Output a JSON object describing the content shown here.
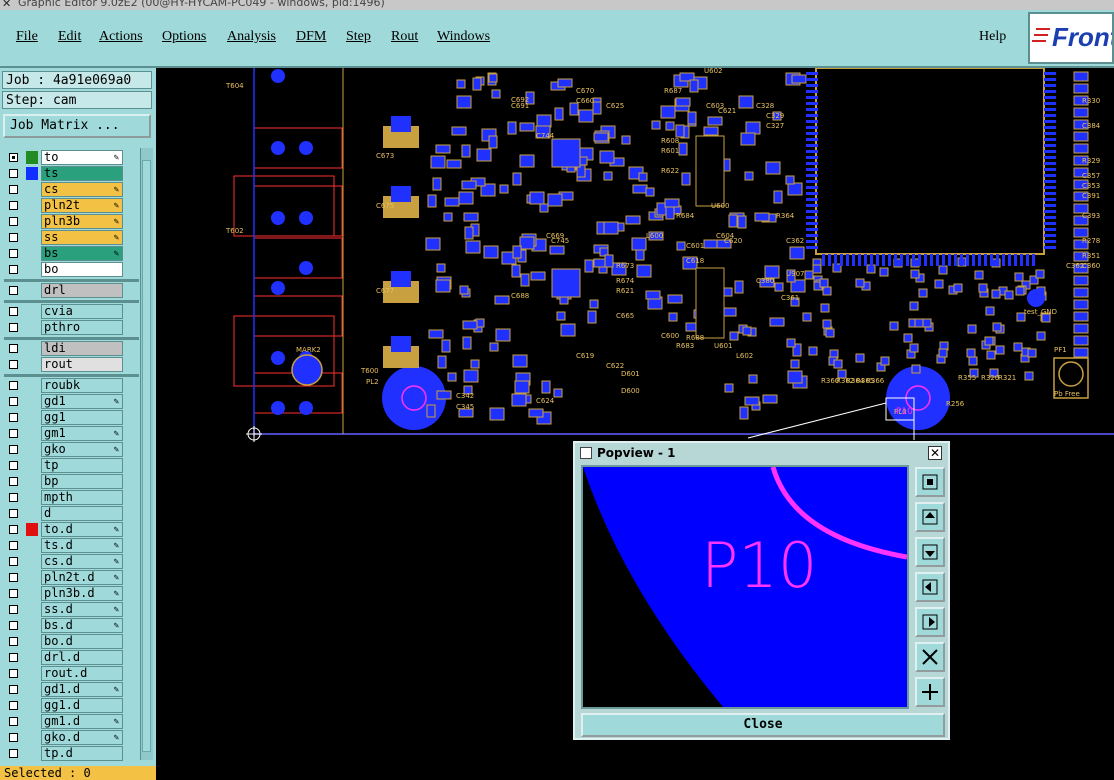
{
  "window": {
    "title": "Graphic Editor 9.0zE2 (00@HY-HYCAM-PC049 - windows, pid:1496)"
  },
  "menu": {
    "items": [
      "File",
      "Edit",
      "Actions",
      "Options",
      "Analysis",
      "DFM",
      "Step",
      "Rout",
      "Windows"
    ],
    "help": "Help",
    "logo": "Frontline"
  },
  "panel": {
    "job": "Job : 4a91e069a0",
    "step": "Step: cam",
    "job_matrix": "Job Matrix ...",
    "selected": "Selected : 0"
  },
  "layers": [
    {
      "name": "to",
      "color": "#ffffff",
      "swatch": "#228b22",
      "active": true,
      "edit": true
    },
    {
      "name": "ts",
      "color": "#2aa07c",
      "swatch": "#1030ff",
      "edit": false
    },
    {
      "name": "cs",
      "color": "#f3c244",
      "edit": true
    },
    {
      "name": "pln2t",
      "color": "#f3c244",
      "edit": true
    },
    {
      "name": "pln3b",
      "color": "#f3c244",
      "edit": true
    },
    {
      "name": "ss",
      "color": "#f3c244",
      "edit": true
    },
    {
      "name": "bs",
      "color": "#2aa07c",
      "edit": true
    },
    {
      "name": "bo",
      "color": "#ffffff",
      "edit": false
    },
    {
      "name": "drl",
      "color": "#c0c0c0",
      "edit": false,
      "gap": true
    },
    {
      "name": "cvia",
      "color": "#9fd9d9",
      "edit": false,
      "gap": true
    },
    {
      "name": "pthro",
      "color": "#9fd9d9",
      "edit": false
    },
    {
      "name": "ldi",
      "color": "#c0c0c0",
      "edit": false,
      "gap": true
    },
    {
      "name": "rout",
      "color": "#e0e0e0",
      "edit": false
    },
    {
      "name": "roubk",
      "color": "#9fd9d9",
      "edit": false,
      "gap": true
    },
    {
      "name": "gd1",
      "color": "#9fd9d9",
      "edit": true
    },
    {
      "name": "gg1",
      "color": "#9fd9d9",
      "edit": false
    },
    {
      "name": "gm1",
      "color": "#9fd9d9",
      "edit": true
    },
    {
      "name": "gko",
      "color": "#9fd9d9",
      "edit": true
    },
    {
      "name": "tp",
      "color": "#9fd9d9",
      "edit": false
    },
    {
      "name": "bp",
      "color": "#9fd9d9",
      "edit": false
    },
    {
      "name": "mpth",
      "color": "#9fd9d9",
      "edit": false
    },
    {
      "name": "d",
      "color": "#9fd9d9",
      "edit": false
    },
    {
      "name": "to.d",
      "color": "#9fd9d9",
      "swatch": "#e01010",
      "edit": true
    },
    {
      "name": "ts.d",
      "color": "#9fd9d9",
      "edit": true
    },
    {
      "name": "cs.d",
      "color": "#9fd9d9",
      "edit": true
    },
    {
      "name": "pln2t.d",
      "color": "#9fd9d9",
      "edit": true
    },
    {
      "name": "pln3b.d",
      "color": "#9fd9d9",
      "edit": true
    },
    {
      "name": "ss.d",
      "color": "#9fd9d9",
      "edit": true
    },
    {
      "name": "bs.d",
      "color": "#9fd9d9",
      "edit": true
    },
    {
      "name": "bo.d",
      "color": "#9fd9d9",
      "edit": false
    },
    {
      "name": "drl.d",
      "color": "#9fd9d9",
      "edit": false
    },
    {
      "name": "rout.d",
      "color": "#9fd9d9",
      "edit": false
    },
    {
      "name": "gd1.d",
      "color": "#9fd9d9",
      "edit": true
    },
    {
      "name": "gg1.d",
      "color": "#9fd9d9",
      "edit": false
    },
    {
      "name": "gm1.d",
      "color": "#9fd9d9",
      "edit": true
    },
    {
      "name": "gko.d",
      "color": "#9fd9d9",
      "edit": true
    },
    {
      "name": "tp.d",
      "color": "#9fd9d9",
      "edit": false
    }
  ],
  "canvas": {
    "labels": [
      "T604",
      "T602",
      "T600",
      "PL2",
      "PL0",
      "MARK2",
      "C345",
      "C342",
      "D600",
      "D601",
      "C624",
      "C619",
      "U600",
      "C745",
      "C669",
      "C688",
      "C691",
      "C692",
      "U601",
      "C601",
      "C604",
      "C620",
      "C618",
      "R687",
      "U602",
      "L600",
      "C603",
      "C621",
      "C361",
      "U907",
      "R364",
      "C362",
      "C384",
      "C353",
      "R330",
      "R329",
      "C391",
      "C393",
      "C357",
      "R278",
      "R351",
      "C360",
      "C362",
      "test_GND",
      "PF1",
      "Pb Free",
      "R360",
      "R362",
      "R364",
      "R365",
      "R366",
      "R256",
      "R355",
      "R320",
      "R321",
      "C625",
      "C622",
      "C677",
      "C675",
      "C673",
      "C665",
      "C670",
      "C660",
      "C744",
      "R673",
      "R674",
      "R621",
      "R622",
      "R608",
      "R601",
      "R684",
      "R683",
      "R688",
      "C600",
      "L602",
      "C328",
      "C329",
      "C327",
      "C380"
    ]
  },
  "popup": {
    "title": "Popview - 1",
    "close_icon": "x-icon",
    "label": "P10",
    "close_button": "Close",
    "tools": [
      "zoom-fit-icon",
      "pan-up-icon",
      "pan-down-icon",
      "pan-left-icon",
      "pan-right-icon",
      "zoom-out-icon",
      "zoom-in-icon"
    ]
  }
}
